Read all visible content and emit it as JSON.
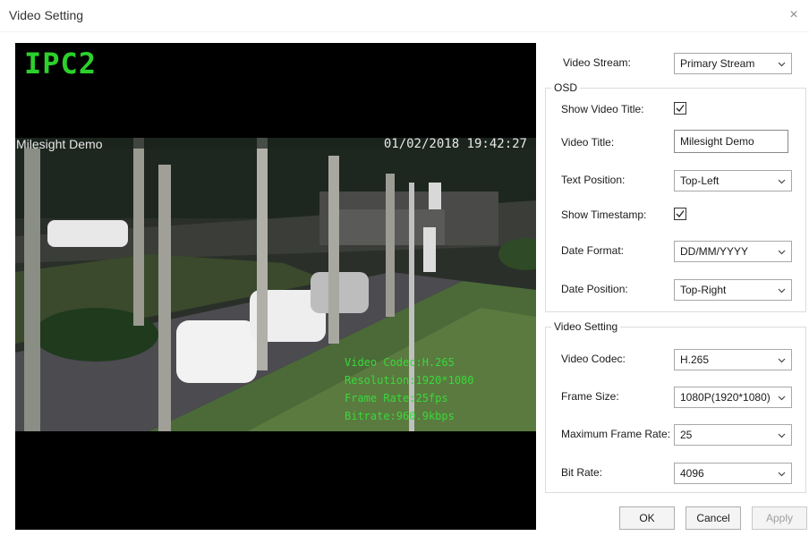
{
  "window": {
    "title": "Video Setting",
    "close_glyph": "×"
  },
  "preview": {
    "osd_channel": "IPC2",
    "osd_video_title": "Milesight Demo",
    "osd_timestamp": "01/02/2018 19:42:27",
    "osd_info": [
      "Video Codec:H.265",
      "Resolution:1920*1080",
      "Frame Rate:25fps",
      "Bitrate:960.9kbps"
    ],
    "colors": {
      "osd_green": "#2bd12b",
      "osd_white": "#e8e8e8"
    }
  },
  "settings": {
    "video_stream": {
      "label": "Video Stream:",
      "value": "Primary Stream"
    },
    "osd_group_label": "OSD",
    "show_video_title": {
      "label": "Show Video Title:",
      "checked": true
    },
    "video_title": {
      "label": "Video Title:",
      "value": "Milesight Demo"
    },
    "text_position": {
      "label": "Text Position:",
      "value": "Top-Left"
    },
    "show_timestamp": {
      "label": "Show Timestamp:",
      "checked": true
    },
    "date_format": {
      "label": "Date Format:",
      "value": "DD/MM/YYYY"
    },
    "date_position": {
      "label": "Date Position:",
      "value": "Top-Right"
    },
    "video_group_label": "Video Setting",
    "video_codec": {
      "label": "Video Codec:",
      "value": "H.265"
    },
    "frame_size": {
      "label": "Frame Size:",
      "value": "1080P(1920*1080)"
    },
    "max_frame_rate": {
      "label": "Maximum Frame Rate:",
      "value": "25"
    },
    "bit_rate": {
      "label": "Bit Rate:",
      "value": "4096"
    }
  },
  "buttons": {
    "ok": "OK",
    "cancel": "Cancel",
    "apply": "Apply"
  },
  "icons": {
    "close": "close-icon",
    "dropdown": "chevron-down-icon",
    "check": "checkmark-icon"
  }
}
